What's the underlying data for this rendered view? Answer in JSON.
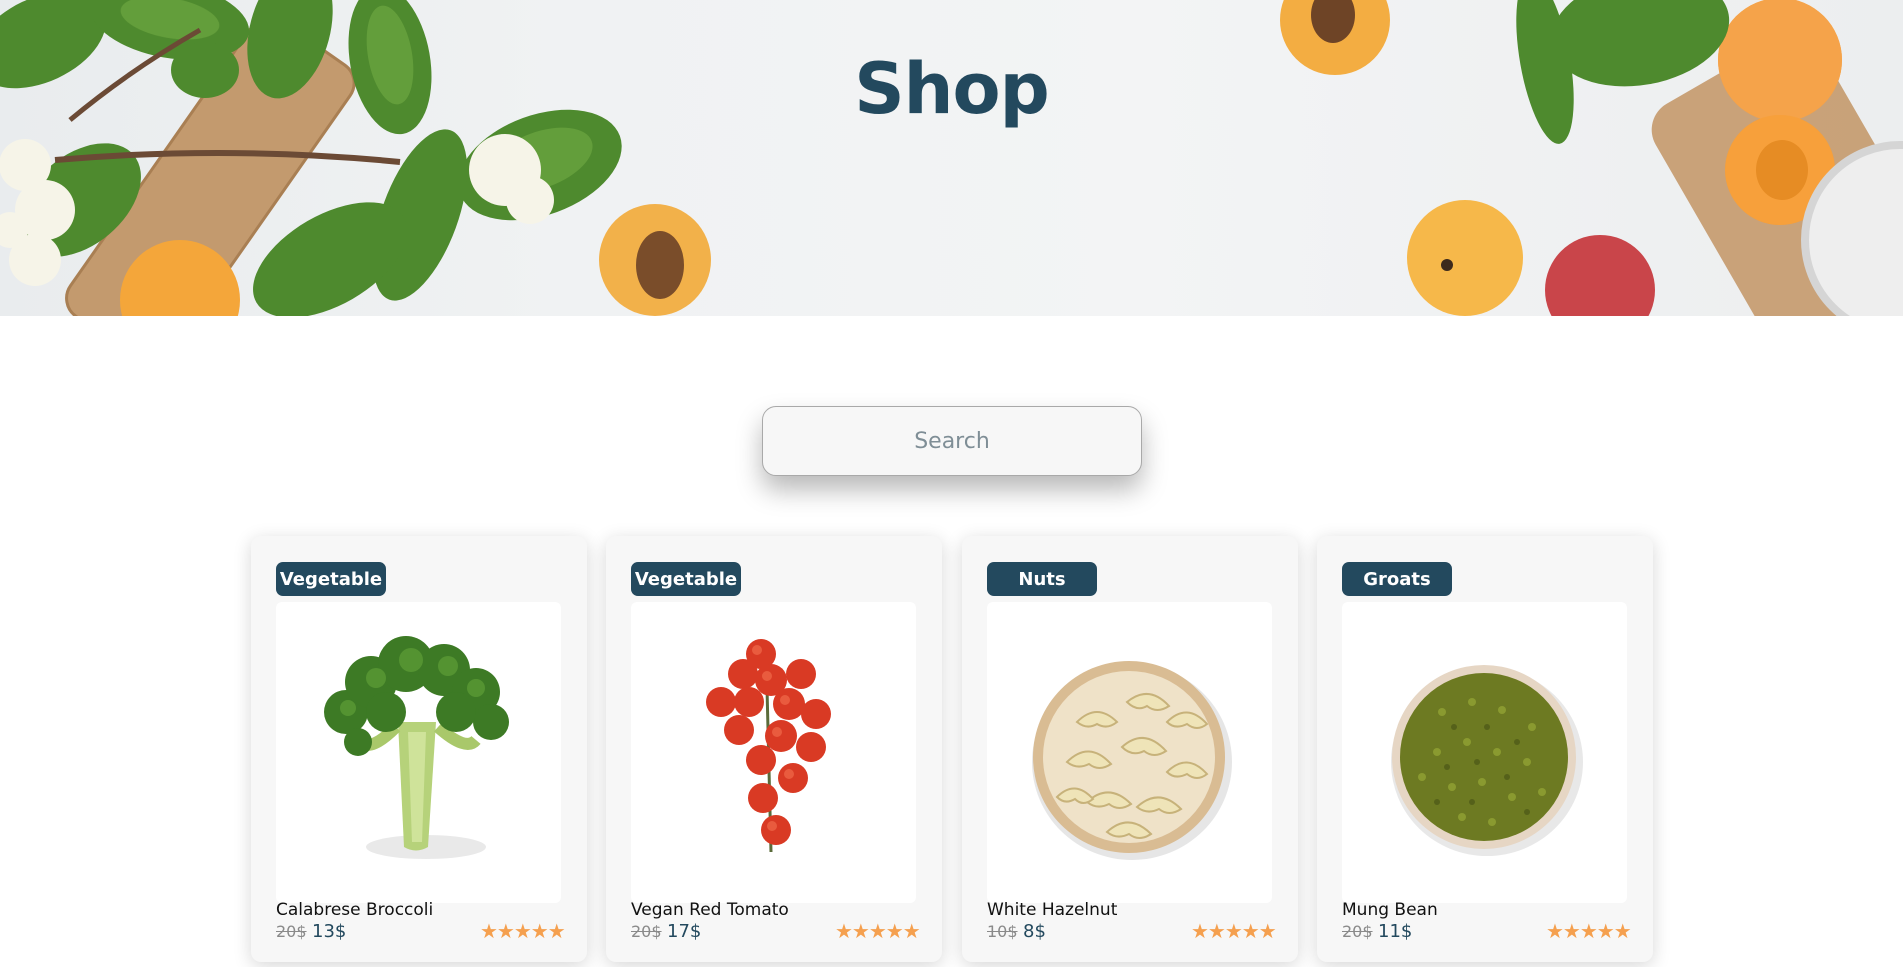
{
  "header": {
    "title": "Shop"
  },
  "search": {
    "placeholder": "Search",
    "value": ""
  },
  "products": [
    {
      "category": "Vegetable",
      "name": "Calabrese Broccoli",
      "old_price": "20$",
      "price": "13$",
      "rating": 5,
      "stars": "★★★★★",
      "image": "broccoli"
    },
    {
      "category": "Vegetable",
      "name": "Vegan Red Tomato",
      "old_price": "20$",
      "price": "17$",
      "rating": 5,
      "stars": "★★★★★",
      "image": "cherry-tomatoes"
    },
    {
      "category": "Nuts",
      "name": "White Hazelnut",
      "old_price": "10$",
      "price": "8$",
      "rating": 5,
      "stars": "★★★★★",
      "image": "cashews-bowl"
    },
    {
      "category": "Groats",
      "name": "Mung Bean",
      "old_price": "20$",
      "price": "11$",
      "rating": 5,
      "stars": "★★★★★",
      "image": "mung-beans-bowl"
    }
  ],
  "colors": {
    "brand": "#23495e",
    "star": "#f5a04f",
    "card_bg": "#f7f7f7"
  }
}
